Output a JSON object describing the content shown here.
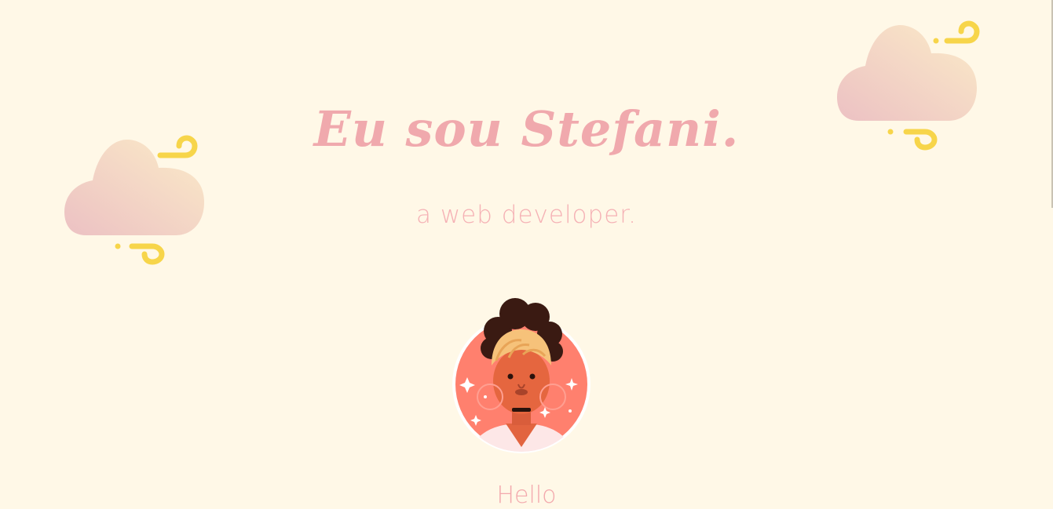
{
  "hero": {
    "title": "Eu sou Stefani.",
    "subtitle": "a web developer."
  },
  "about": {
    "heading": "Hello"
  },
  "icons": {
    "cloud_left": "wind-cloud-icon",
    "cloud_right": "wind-cloud-icon",
    "avatar": "woman-avatar-illustration"
  },
  "colors": {
    "background": "#fff8e7",
    "accent_pink": "#f0a9ad",
    "wind_yellow": "#f7d54a",
    "cloud_top": "#fbeac6",
    "cloud_bottom": "#eec4c4",
    "avatar_bg": "#ff806e"
  }
}
